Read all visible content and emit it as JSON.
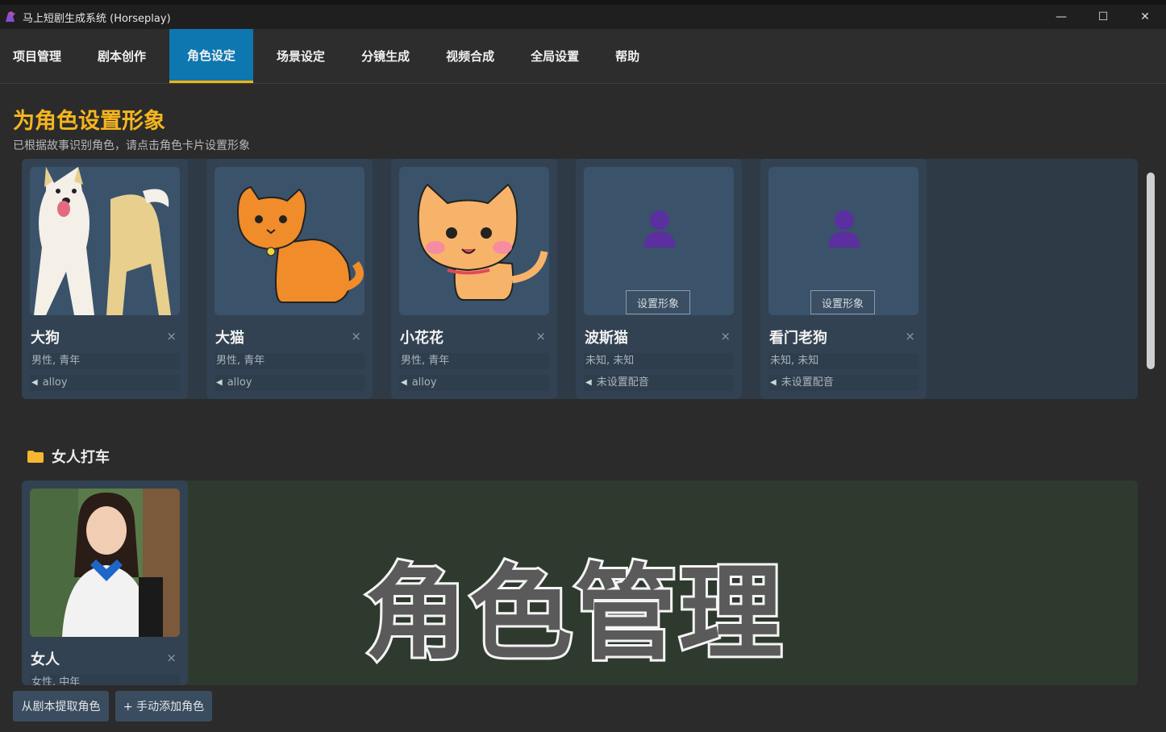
{
  "window": {
    "title": "马上短剧生成系统 (Horseplay)",
    "controls": {
      "minimize": "—",
      "maximize": "☐",
      "close": "✕"
    }
  },
  "tabs": [
    {
      "label": "项目管理"
    },
    {
      "label": "剧本创作"
    },
    {
      "label": "角色设定",
      "active": true
    },
    {
      "label": "场景设定"
    },
    {
      "label": "分镜生成"
    },
    {
      "label": "视频合成"
    },
    {
      "label": "全局设置"
    },
    {
      "label": "帮助"
    }
  ],
  "page": {
    "heading": "为角色设置形象",
    "subtitle": "已根据故事识别角色，请点击角色卡片设置形象"
  },
  "group1": {
    "cards": [
      {
        "name": "大狗",
        "meta": "男性, 青年",
        "voice": "alloy",
        "image": "shiba-dog"
      },
      {
        "name": "大猫",
        "meta": "男性, 青年",
        "voice": "alloy",
        "image": "orange-cat"
      },
      {
        "name": "小花花",
        "meta": "男性, 青年",
        "voice": "alloy",
        "image": "cute-cat"
      },
      {
        "name": "波斯猫",
        "meta": "未知, 未知",
        "voice": "未设置配音",
        "set_look": "设置形象"
      },
      {
        "name": "看门老狗",
        "meta": "未知, 未知",
        "voice": "未设置配音",
        "set_look": "设置形象"
      }
    ],
    "close_glyph": "×"
  },
  "group2": {
    "folder_label": "女人打车",
    "cards": [
      {
        "name": "女人",
        "meta": "女性, 中年"
      }
    ]
  },
  "overlay_text": "角色管理",
  "buttons": {
    "extract": "从剧本提取角色",
    "add_manual": "+ 手动添加角色"
  },
  "colors": {
    "accent_tab": "#0e77b0",
    "tab_underline": "#ffb400",
    "heading": "#f5b51e",
    "card_bg": "#324252"
  }
}
